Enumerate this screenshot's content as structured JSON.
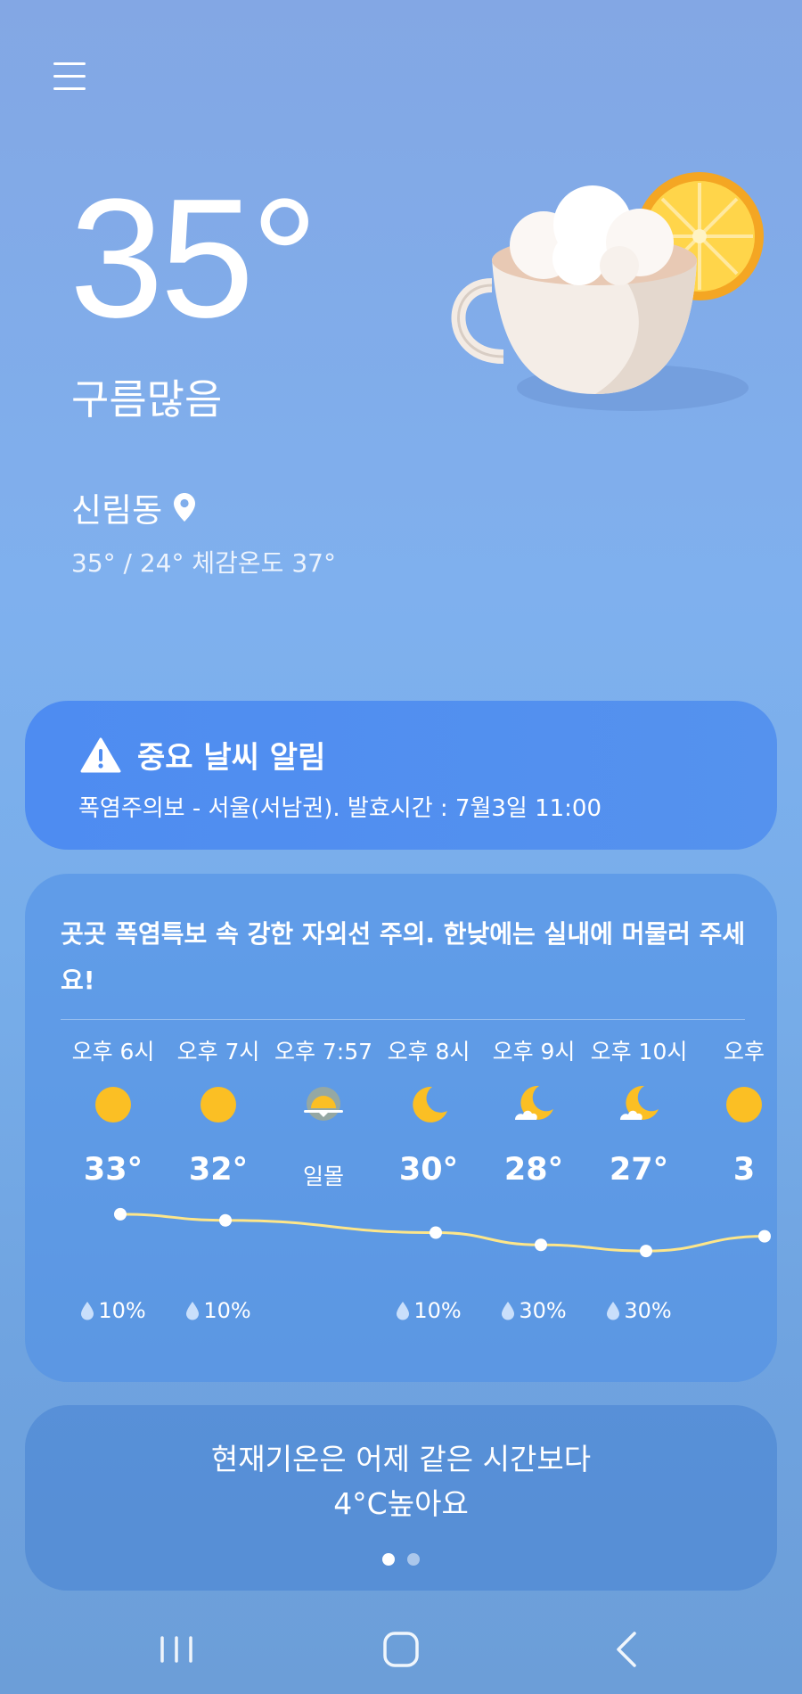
{
  "current": {
    "temperature": "35°",
    "condition": "구름많음",
    "location": "신림동",
    "hi_lo_feels": "35° / 24° 체감온도 37°"
  },
  "alert": {
    "title": "중요 날씨 알림",
    "body": "폭염주의보 - 서울(서남권). 발효시간 : 7월3일 11:00"
  },
  "forecast": {
    "message": "곳곳 폭염특보 속 강한 자외선 주의. 한낮에는 실내에 머물러 주세요!",
    "hours": [
      {
        "time": "오후 6시",
        "icon": "sun-icon",
        "temp": "33°",
        "temp_value": 33,
        "rain": "10%"
      },
      {
        "time": "오후 7시",
        "icon": "sun-icon",
        "temp": "32°",
        "temp_value": 32,
        "rain": "10%"
      },
      {
        "time": "오후 7:57",
        "icon": "sunset-icon",
        "temp": "일몰",
        "temp_value": null,
        "rain": ""
      },
      {
        "time": "오후 8시",
        "icon": "moon-icon",
        "temp": "30°",
        "temp_value": 30,
        "rain": "10%"
      },
      {
        "time": "오후 9시",
        "icon": "moon-cloud-icon",
        "temp": "28°",
        "temp_value": 28,
        "rain": "30%"
      },
      {
        "time": "오후 10시",
        "icon": "moon-cloud-icon",
        "temp": "27°",
        "temp_value": 27,
        "rain": "30%"
      },
      {
        "time": "오후",
        "icon": "sun-icon",
        "temp": "3",
        "temp_value": null,
        "rain": ""
      }
    ]
  },
  "comparison": {
    "line1": "현재기온은 어제 같은 시간보다",
    "line2": "4°C높아요"
  },
  "colors": {
    "sun": "#fbbf24",
    "trend_line": "#fde68a",
    "alert_bg": "#4e8cf1"
  }
}
